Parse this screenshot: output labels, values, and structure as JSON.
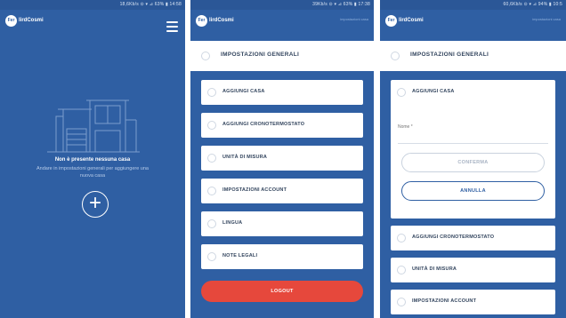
{
  "colors": {
    "primary_blue": "#2f5fa3",
    "logout_red": "#e6483c",
    "text_dark": "#33455e"
  },
  "screen1": {
    "status_text": "18,6Kb/s ⊙ ▾ ⊿ 63% ▮ 14:58",
    "logo_badge": "Fer",
    "logo_text": "lirdCosmi",
    "hamburger_icon": "menu-icon",
    "empty_title": "Non è presente nessuna casa",
    "empty_subtitle": "Andare in impostazioni generali per aggiungere una nuova casa",
    "add_symbol": "+"
  },
  "screen2": {
    "status_text": "39Kb/s ⊙ ▾ ⊿ 63% ▮ 17:38",
    "logo_badge": "Fer",
    "logo_text": "lirdCosmi",
    "topbar_right": "impostazioni casa",
    "header_title": "IMPOSTAZIONI GENERALI",
    "items": [
      "AGGIUNGI CASA",
      "AGGIUNGI CRONOTERMOSTATO",
      "UNITÀ DI MISURA",
      "IMPOSTAZIONI ACCOUNT",
      "LINGUA",
      "NOTE LEGALI"
    ],
    "logout_label": "LOGOUT"
  },
  "screen3": {
    "status_text": "60,6Kb/s ⊙ ▾ ⊿ 94% ▮ 10:5",
    "logo_badge": "Fer",
    "logo_text": "lirdCosmi",
    "topbar_right": "impostazioni casa",
    "header_title": "IMPOSTAZIONI GENERALI",
    "expanded_label": "AGGIUNGI CASA",
    "name_placeholder": "Nome *",
    "confirm_label": "CONFERMA",
    "cancel_label": "ANNULLA",
    "items": [
      "AGGIUNGI CRONOTERMOSTATO",
      "UNITÀ DI MISURA",
      "IMPOSTAZIONI ACCOUNT"
    ]
  }
}
